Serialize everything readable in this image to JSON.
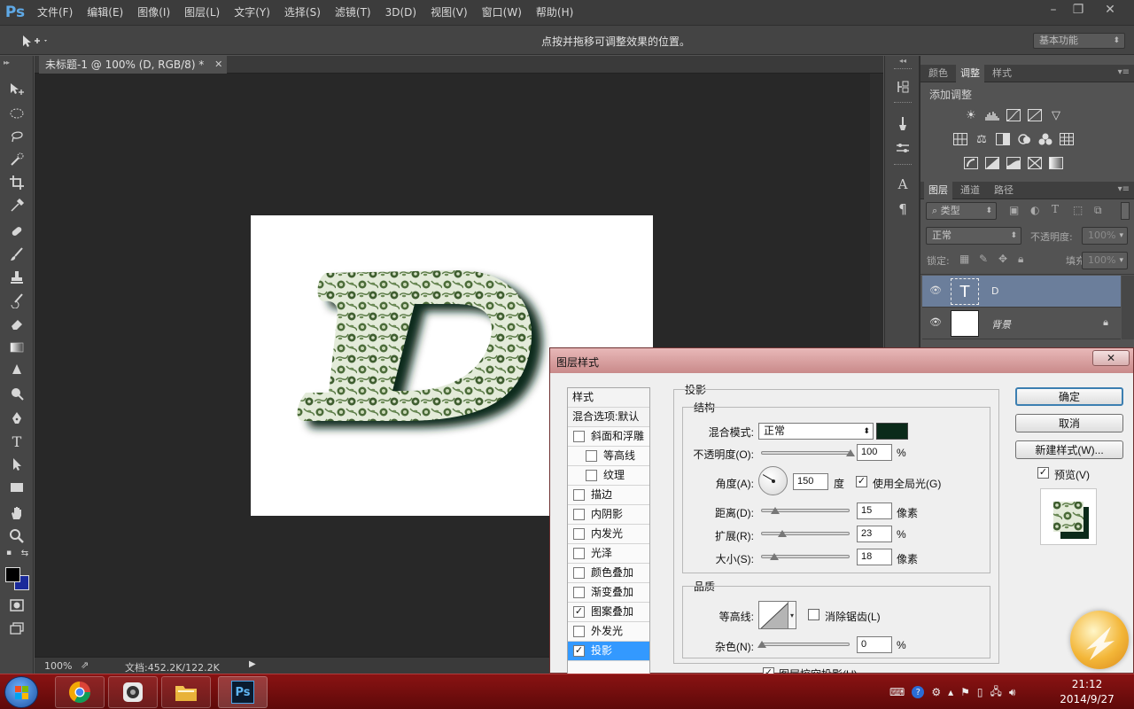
{
  "app": {
    "logo": "Ps",
    "menu": [
      "文件(F)",
      "编辑(E)",
      "图像(I)",
      "图层(L)",
      "文字(Y)",
      "选择(S)",
      "滤镜(T)",
      "3D(D)",
      "视图(V)",
      "窗口(W)",
      "帮助(H)"
    ],
    "window_controls": [
      "minimize-icon",
      "restore-icon",
      "close-icon"
    ]
  },
  "options_bar": {
    "hint": "点按并拖移可调整效果的位置。",
    "workspace": "基本功能"
  },
  "document": {
    "tab_title": "未标题-1 @ 100% (D, RGB/8) *",
    "zoom": "100%",
    "doc_info": "文档:452.2K/122.2K",
    "canvas_letter": "D"
  },
  "panels": {
    "adjust_tabs": [
      "颜色",
      "调整",
      "样式"
    ],
    "adjust_active": "调整",
    "adjust_title": "添加调整",
    "layers_tabs": [
      "图层",
      "通道",
      "路径"
    ],
    "layers_active": "图层",
    "filter_kind": "类型",
    "blend_mode": "正常",
    "opacity_label": "不透明度:",
    "opacity_value": "100%",
    "lock_label": "锁定:",
    "fill_label": "填充:",
    "fill_value": "100%",
    "layers": [
      {
        "name": "D",
        "type": "text",
        "selected": true
      },
      {
        "name": "背景",
        "type": "background",
        "locked": true
      }
    ]
  },
  "dialog": {
    "title": "图层样式",
    "styles_header": "样式",
    "blend_default": "混合选项:默认",
    "style_items": [
      {
        "label": "斜面和浮雕",
        "checked": false,
        "indent": false
      },
      {
        "label": "等高线",
        "checked": false,
        "indent": true
      },
      {
        "label": "纹理",
        "checked": false,
        "indent": true
      },
      {
        "label": "描边",
        "checked": false,
        "indent": false
      },
      {
        "label": "内阴影",
        "checked": false,
        "indent": false
      },
      {
        "label": "内发光",
        "checked": false,
        "indent": false
      },
      {
        "label": "光泽",
        "checked": false,
        "indent": false
      },
      {
        "label": "颜色叠加",
        "checked": false,
        "indent": false
      },
      {
        "label": "渐变叠加",
        "checked": false,
        "indent": false
      },
      {
        "label": "图案叠加",
        "checked": true,
        "indent": false
      },
      {
        "label": "外发光",
        "checked": false,
        "indent": false
      },
      {
        "label": "投影",
        "checked": true,
        "indent": false,
        "selected": true
      }
    ],
    "section_title": "投影",
    "structure_title": "结构",
    "blend_mode_label": "混合模式:",
    "blend_mode_value": "正常",
    "shadow_color": "#0b2a1a",
    "opacity_label": "不透明度(O):",
    "opacity_value": "100",
    "opacity_pct": 100,
    "percent_unit": "%",
    "angle_label": "角度(A):",
    "angle_value": "150",
    "angle_unit": "度",
    "global_light_label": "使用全局光(G)",
    "global_light_checked": true,
    "distance_label": "距离(D):",
    "distance_value": "15",
    "distance_unit": "像素",
    "spread_label": "扩展(R):",
    "spread_value": "23",
    "size_label": "大小(S):",
    "size_value": "18",
    "size_unit": "像素",
    "quality_title": "品质",
    "contour_label": "等高线:",
    "antialias_label": "消除锯齿(L)",
    "antialias_checked": false,
    "noise_label": "杂色(N):",
    "noise_value": "0",
    "knockout_label": "图层挖空投影(U)",
    "knockout_checked": true,
    "ok_label": "确定",
    "cancel_label": "取消",
    "new_style_label": "新建样式(W)...",
    "preview_label": "预览(V)",
    "preview_checked": true
  },
  "taskbar": {
    "apps": [
      "chrome-icon",
      "camera-app-icon",
      "file-explorer-icon",
      "photoshop-icon"
    ],
    "photoshop_label": "Ps",
    "time": "21:12",
    "date": "2014/9/27"
  },
  "colors": {
    "foreground": "#000000",
    "background": "#1a2a9a",
    "selected_layer": "#6b7e9b",
    "list_selection": "#3399ff"
  }
}
